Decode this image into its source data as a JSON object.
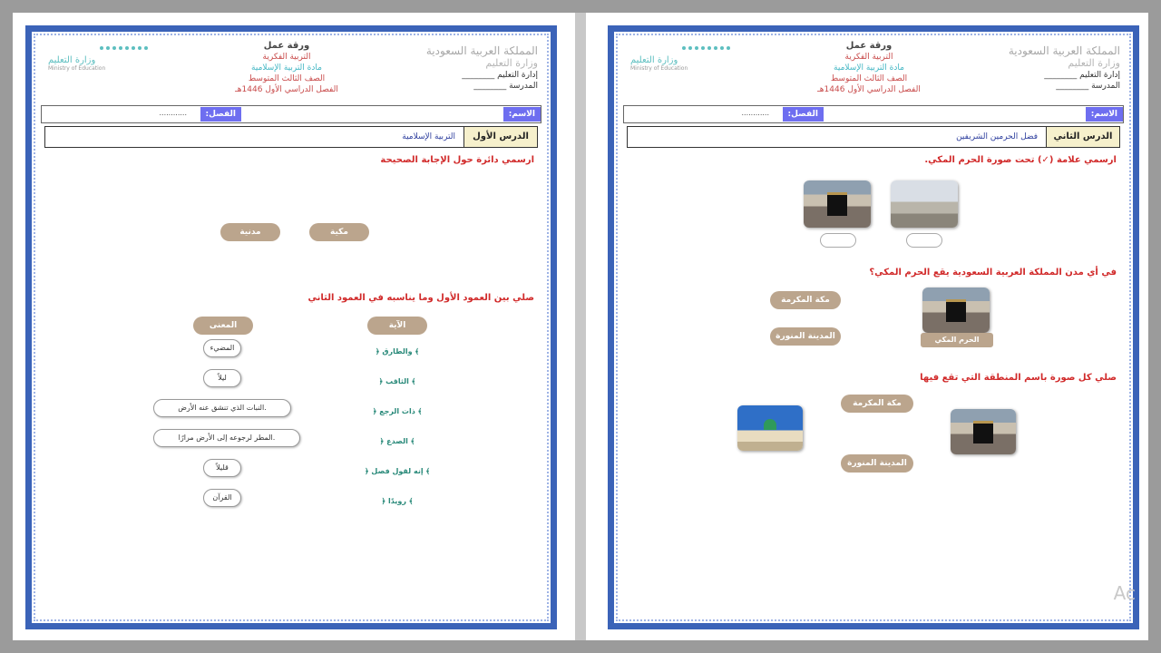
{
  "header": {
    "kingdom": "المملكة العربية السعودية",
    "ministry_ar": "وزارة التعليم",
    "admin_label": "إدارة التعليم",
    "school_label": "المدرسة",
    "worksheet": "ورقة عمل",
    "subject": "التربية الفكرية",
    "material": "مادة التربية الإسلامية",
    "grade": "الصف الثالث المتوسط",
    "semester": "الفصل الدراسي الأول 1446هـ",
    "moe_logo": "وزارة التعليم",
    "moe_en": "Ministry of Education"
  },
  "form": {
    "name_label": "الاسم:",
    "class_label": "الفصل:",
    "dots": "............"
  },
  "left_page": {
    "lesson_label": "الدرس الأول",
    "lesson_title": "التربية الإسلامية",
    "q1": "ارسمي دائرة حول الإجابة الصحيحة",
    "q1_options": [
      "مكية",
      "مدنية"
    ],
    "q2": "صلي بين العمود الأول وما يناسبه في العمود الثاني",
    "col_ayah": "الآية",
    "col_meaning": "المعنى",
    "ayat": [
      "﴿ والطارق ﴾",
      "﴿ الثاقب ﴾",
      "﴿ ذات الرجع ﴾",
      "﴿ الصدع ﴾",
      "﴿ إنه لقول فصل ﴾",
      "﴿ رويدًا ﴾"
    ],
    "meanings": [
      "المضيء",
      "ليلاً",
      "النبات الذي تنشق عنه الأرض.",
      "المطر لرجوعه إلى الأرض مرارًا.",
      "قليلاً",
      "القرآن"
    ]
  },
  "right_page": {
    "lesson_label": "الدرس الثاني",
    "lesson_title": "فضل الحرمين الشريفين",
    "q1": "ارسمي علامة (✓) تحت صورة الحرم المكي.",
    "q2": "في أي مدن المملكة العربية السعودية يقع الحرم المكي؟",
    "q2_options": [
      "مكة المكرمة",
      "المدينة المنورة"
    ],
    "q2_caption": "الحرم المكي",
    "q3": "صلي كل صورة باسم المنطقة التي تقع فيها",
    "q3_options": [
      "مكة المكرمة",
      "المدينة المنورة"
    ]
  },
  "watermark": "Ac"
}
